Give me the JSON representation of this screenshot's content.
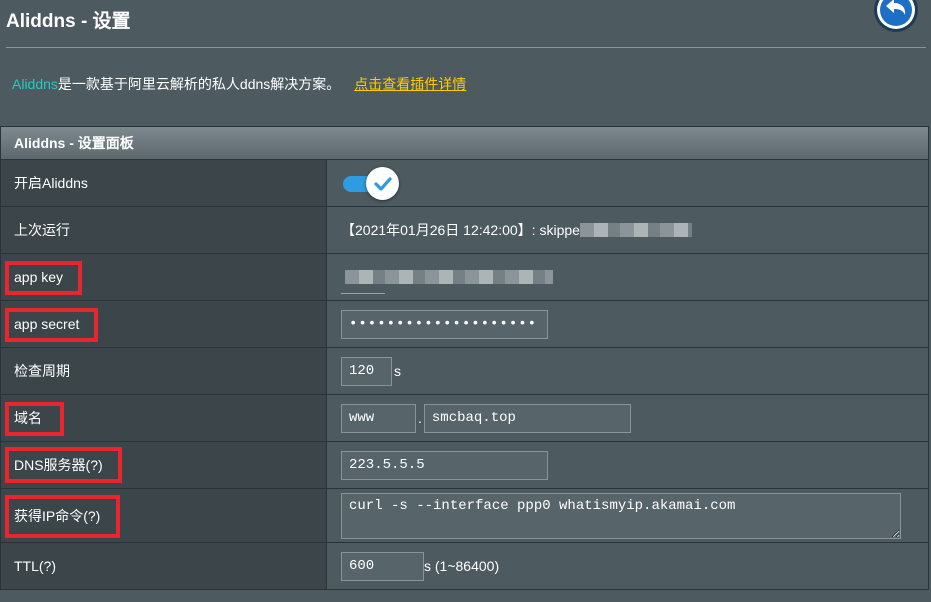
{
  "header": {
    "title": "Aliddns - 设置",
    "back_icon": "back-arrow-icon"
  },
  "description": {
    "brand": "Aliddns",
    "text": "是一款基于阿里云解析的私人ddns解决方案。",
    "link": "点击查看插件详情"
  },
  "panel": {
    "title": "Aliddns - 设置面板",
    "enable": {
      "label": "开启Aliddns",
      "checked": true
    },
    "last_run": {
      "label": "上次运行",
      "value": "【2021年01月26日 12:42:00】: skippe"
    },
    "app_key": {
      "label": "app key",
      "value": ""
    },
    "app_secret": {
      "label": "app secret",
      "value": "••••••••••••••••••••"
    },
    "interval": {
      "label": "检查周期",
      "value": "120",
      "unit": "s"
    },
    "domain": {
      "label": "域名",
      "sub": "www",
      "separator": ".",
      "main": "smcbaq.top"
    },
    "dns_server": {
      "label": "DNS服务器(?)",
      "value": "223.5.5.5"
    },
    "ip_cmd": {
      "label": "获得IP命令(?)",
      "value": "curl -s --interface ppp0 whatismyip.akamai.com"
    },
    "ttl": {
      "label": "TTL(?)",
      "value": "600",
      "unit": "s (1~86400)"
    }
  },
  "colors": {
    "background": "#4d5a60",
    "label_cell": "#3b454a",
    "highlight_box": "#e8262d",
    "brand_text": "#25c9c4",
    "link_text": "#ffcc00",
    "toggle_on": "#2f9be0"
  }
}
